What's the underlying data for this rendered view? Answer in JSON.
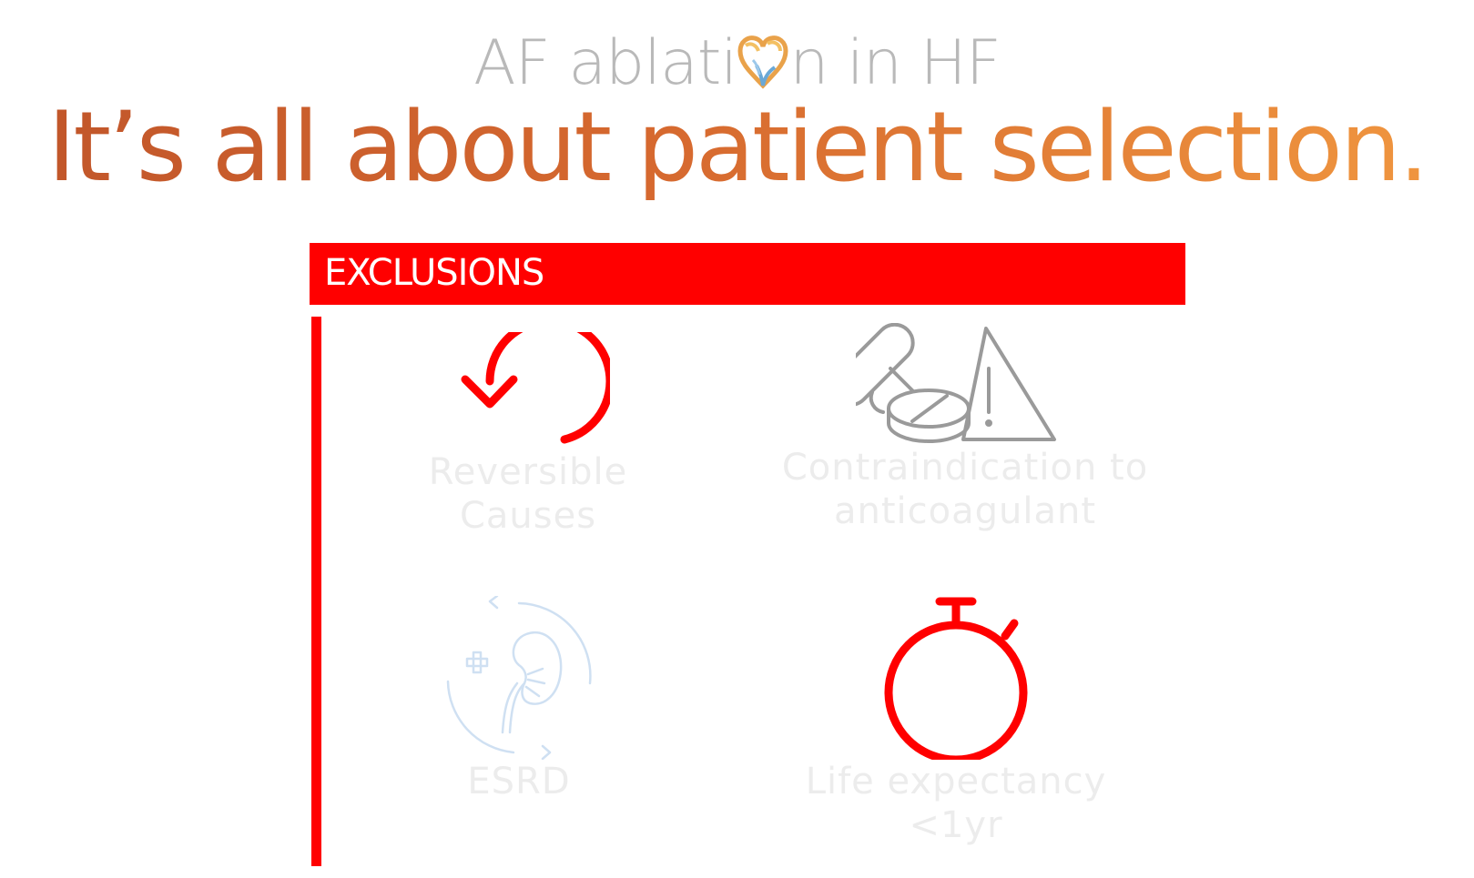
{
  "header": {
    "subtitle_before": "AF ablati",
    "subtitle_after": "n  in HF",
    "headline": "It’s all about patient selection."
  },
  "banner": {
    "label": "EXCLUSIONS"
  },
  "items": [
    {
      "label": "Reversible Causes",
      "icon": "undo-arrow-icon"
    },
    {
      "label": "Contraindication to anticoagulant",
      "icon": "pills-warning-icon"
    },
    {
      "label": "ESRD",
      "icon": "kidney-icon"
    },
    {
      "label": "Life expectancy <1yr",
      "icon": "stopwatch-icon"
    }
  ],
  "colors": {
    "accent": "#ff0000",
    "title_start": "#c0552a",
    "title_end": "#f19840",
    "subtitle": "#b9b9b9",
    "label": "#ececec",
    "icon_gray": "#9a9a9a",
    "icon_blue": "#cfe0f2"
  }
}
